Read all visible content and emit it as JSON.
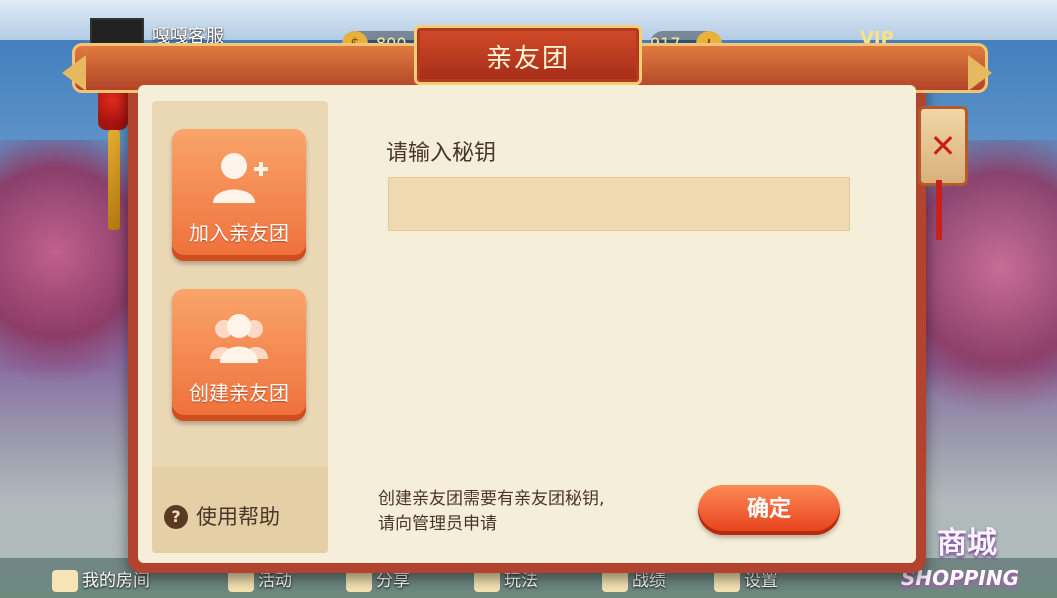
{
  "topbar": {
    "username": "嘎嘎客服",
    "coins": "800",
    "gems": "917",
    "vip_label": "VIP"
  },
  "dialog": {
    "title": "亲友团",
    "sidebar": {
      "join_label": "加入亲友团",
      "create_label": "创建亲友团",
      "help_label": "使用帮助"
    },
    "main": {
      "prompt": "请输入秘钥",
      "input_value": "",
      "input_placeholder": "",
      "notice_line1": "创建亲友团需要有亲友团秘钥,",
      "notice_line2": "请向管理员申请",
      "confirm_label": "确定"
    }
  },
  "bottomnav": {
    "items": [
      {
        "label": "我的房间"
      },
      {
        "label": "活动"
      },
      {
        "label": "分享"
      },
      {
        "label": "玩法"
      },
      {
        "label": "战绩"
      },
      {
        "label": "设置"
      }
    ],
    "shop_cn": "商城",
    "shop_en": "SHOPPING"
  },
  "colors": {
    "frame": "#b2432f",
    "panel": "#f5eed9",
    "button_orange": "#ef6f3a",
    "confirm_red": "#e53f1b"
  }
}
